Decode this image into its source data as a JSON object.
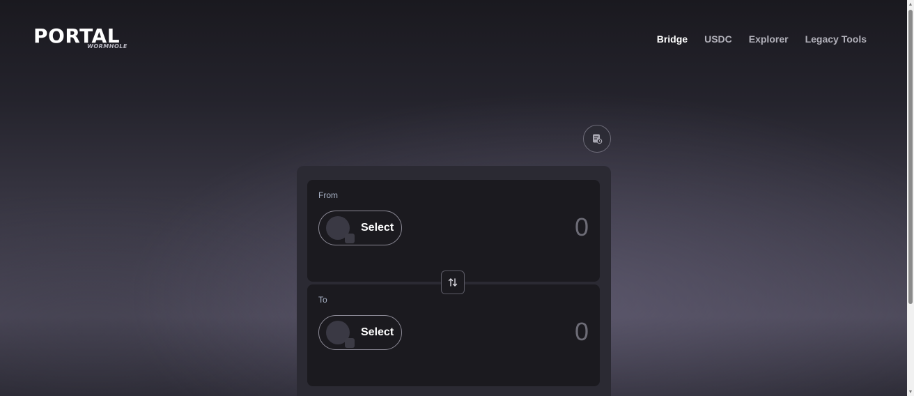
{
  "header": {
    "logo_main": "PORTAL",
    "logo_sub": "WORMHOLE",
    "nav": [
      {
        "label": "Bridge",
        "active": true
      },
      {
        "label": "USDC",
        "active": false
      },
      {
        "label": "Explorer",
        "active": false
      },
      {
        "label": "Legacy Tools",
        "active": false
      }
    ]
  },
  "settings": {
    "icon": "transaction-history-icon"
  },
  "bridge": {
    "from": {
      "label": "From",
      "select_label": "Select",
      "amount": "0"
    },
    "to": {
      "label": "To",
      "select_label": "Select",
      "amount": "0"
    },
    "swap_icon": "swap-arrows-icon"
  },
  "colors": {
    "card_bg": "#2b2a33",
    "panel_bg": "#1b1a1f",
    "label_text": "#a9b3c6",
    "amount_text": "#6d6c76",
    "nav_active": "#ffffff",
    "nav_inactive": "#b2b1ba"
  }
}
